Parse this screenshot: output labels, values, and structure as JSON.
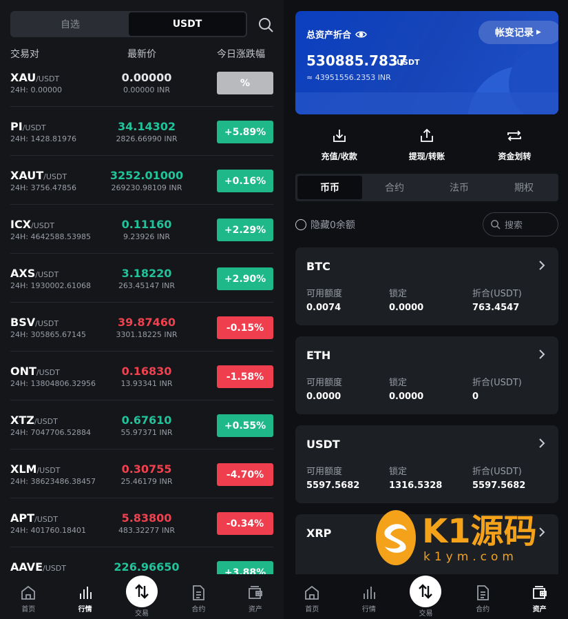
{
  "left": {
    "segments": [
      "自选",
      "USDT"
    ],
    "active_segment": 1,
    "columns": {
      "pair": "交易对",
      "price": "最新价",
      "change": "今日涨跌幅"
    },
    "rows": [
      {
        "base": "XAU",
        "quote": "/USDT",
        "vol": "24H: 0.00000",
        "price": "0.00000",
        "inr": "0.00000 INR",
        "change": "%",
        "dir": "flat"
      },
      {
        "base": "PI",
        "quote": "/USDT",
        "vol": "24H: 1428.81976",
        "price": "34.14302",
        "inr": "2826.66990 INR",
        "change": "+5.89%",
        "dir": "up"
      },
      {
        "base": "XAUT",
        "quote": "/USDT",
        "vol": "24H: 3756.47856",
        "price": "3252.01000",
        "inr": "269230.98109 INR",
        "change": "+0.16%",
        "dir": "up"
      },
      {
        "base": "ICX",
        "quote": "/USDT",
        "vol": "24H: 4642588.53985",
        "price": "0.11160",
        "inr": "9.23926 INR",
        "change": "+2.29%",
        "dir": "up"
      },
      {
        "base": "AXS",
        "quote": "/USDT",
        "vol": "24H: 1930002.61068",
        "price": "3.18220",
        "inr": "263.45147 INR",
        "change": "+2.90%",
        "dir": "up"
      },
      {
        "base": "BSV",
        "quote": "/USDT",
        "vol": "24H: 305865.67145",
        "price": "39.87460",
        "inr": "3301.18225 INR",
        "change": "-0.15%",
        "dir": "down"
      },
      {
        "base": "ONT",
        "quote": "/USDT",
        "vol": "24H: 13804806.32956",
        "price": "0.16830",
        "inr": "13.93341 INR",
        "change": "-1.58%",
        "dir": "down"
      },
      {
        "base": "XTZ",
        "quote": "/USDT",
        "vol": "24H: 7047706.52884",
        "price": "0.67610",
        "inr": "55.97371 INR",
        "change": "+0.55%",
        "dir": "up"
      },
      {
        "base": "XLM",
        "quote": "/USDT",
        "vol": "24H: 38623486.38457",
        "price": "0.30755",
        "inr": "25.46179 INR",
        "change": "-4.70%",
        "dir": "down"
      },
      {
        "base": "APT",
        "quote": "/USDT",
        "vol": "24H: 401760.18401",
        "price": "5.83800",
        "inr": "483.32277 INR",
        "change": "-0.34%",
        "dir": "down"
      },
      {
        "base": "AAVE",
        "quote": "/USDT",
        "vol": "",
        "price": "226.96650",
        "inr": "",
        "change": "+3.88%",
        "dir": "up"
      }
    ],
    "tabs": [
      {
        "label": "首页",
        "icon": "home-icon"
      },
      {
        "label": "行情",
        "icon": "chart-bars-icon"
      },
      {
        "label": "交易",
        "icon": "swap-vertical-icon"
      },
      {
        "label": "合约",
        "icon": "document-icon"
      },
      {
        "label": "资产",
        "icon": "wallet-icon"
      }
    ],
    "active_tab": 1
  },
  "right": {
    "asset_title": "总资产折合",
    "ledger_label": "帐变记录",
    "balance": "530885.7837",
    "balance_unit": "USDT",
    "balance_inr": "≈ 43951556.2353 INR",
    "actions": [
      {
        "label": "充值/收款",
        "icon": "download-icon"
      },
      {
        "label": "提现/转账",
        "icon": "upload-icon"
      },
      {
        "label": "资金划转",
        "icon": "transfer-icon"
      }
    ],
    "segments": [
      "币币",
      "合约",
      "法币",
      "期权"
    ],
    "active_segment": 0,
    "hide_zero": "隐藏0余额",
    "search_placeholder": "搜索",
    "labels": {
      "available": "可用额度",
      "locked": "锁定",
      "converted": "折合(USDT)"
    },
    "coins": [
      {
        "name": "BTC",
        "available": "0.0074",
        "locked": "0.0000",
        "converted": "763.4547"
      },
      {
        "name": "ETH",
        "available": "0.0000",
        "locked": "0.0000",
        "converted": "0"
      },
      {
        "name": "USDT",
        "available": "5597.5682",
        "locked": "1316.5328",
        "converted": "5597.5682"
      },
      {
        "name": "XRP",
        "available": "",
        "locked": "",
        "converted": ""
      }
    ],
    "tabs": [
      {
        "label": "首页",
        "icon": "home-icon"
      },
      {
        "label": "行情",
        "icon": "chart-bars-icon"
      },
      {
        "label": "交易",
        "icon": "swap-vertical-icon"
      },
      {
        "label": "合约",
        "icon": "document-icon"
      },
      {
        "label": "资产",
        "icon": "wallet-icon"
      }
    ],
    "active_tab": 4
  },
  "watermark": {
    "text": "K1源码",
    "sub": "k1ym.com"
  },
  "colors": {
    "up": "#1fb889",
    "down": "#ef3e4e",
    "card": "#0b3fbf"
  }
}
